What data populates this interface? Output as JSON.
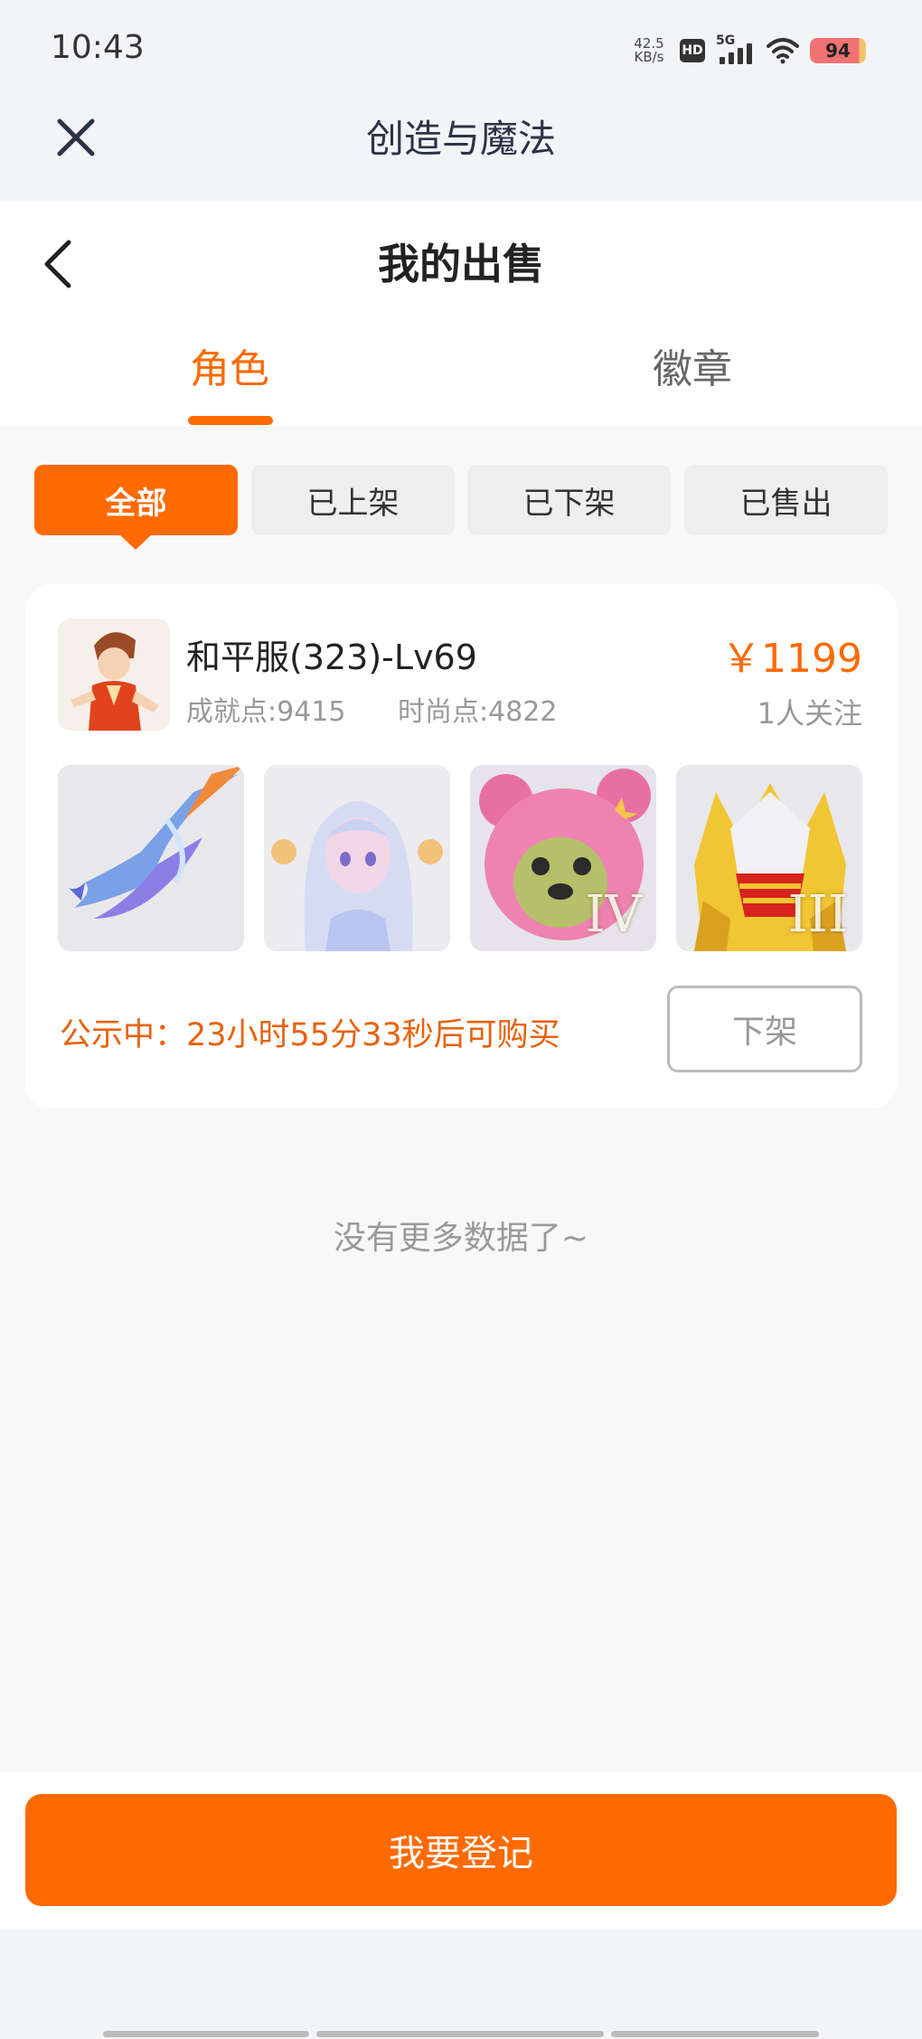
{
  "status_bar": {
    "time": "10:43",
    "net_speed_value": "42.5",
    "net_speed_unit": "KB/s",
    "hd_label": "HD",
    "network_label": "5G",
    "battery": "94"
  },
  "app_header": {
    "title": "创造与魔法"
  },
  "page": {
    "title": "我的出售",
    "tabs": [
      {
        "label": "角色",
        "active": true
      },
      {
        "label": "徽章",
        "active": false
      }
    ],
    "filters": [
      {
        "label": "全部",
        "active": true
      },
      {
        "label": "已上架",
        "active": false
      },
      {
        "label": "已下架",
        "active": false
      },
      {
        "label": "已售出",
        "active": false
      }
    ],
    "listing": {
      "name": "和平服(323)-Lv69",
      "achievement_points": "成就点:9415",
      "fashion_points": "时尚点:4822",
      "price": "￥1199",
      "followers": "1人关注",
      "thumbnails": [
        {
          "icon": "blue-dragon-mount-icon",
          "tier": ""
        },
        {
          "icon": "white-hair-character-icon",
          "tier": ""
        },
        {
          "icon": "pink-bear-costume-icon",
          "tier": "IV"
        },
        {
          "icon": "golden-armor-icon",
          "tier": "III"
        }
      ],
      "countdown": "公示中：23小时55分33秒后可购买",
      "delist_label": "下架"
    },
    "no_more_text": "没有更多数据了~"
  },
  "bottom": {
    "register_label": "我要登记"
  },
  "colors": {
    "accent": "#ff6a00",
    "background": "#f8f8f8",
    "header_background": "#f2f4f7"
  }
}
